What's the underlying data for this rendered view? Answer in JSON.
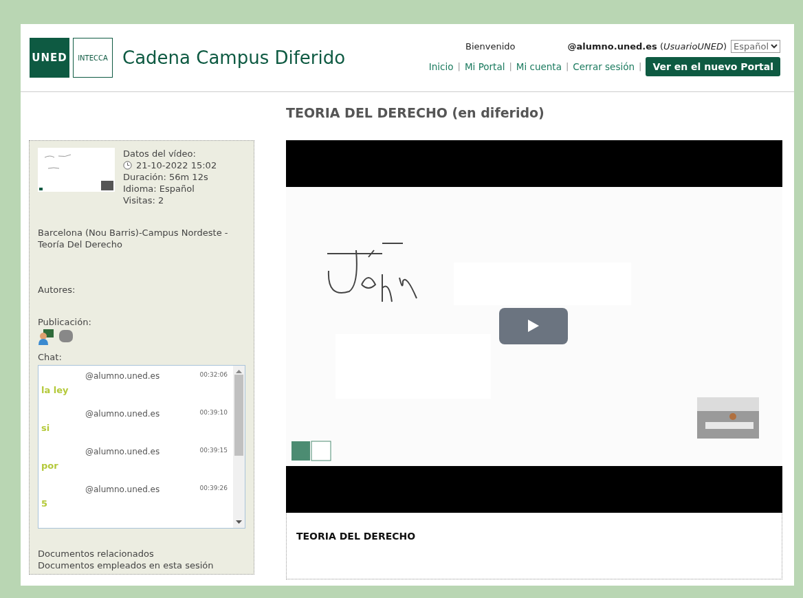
{
  "header": {
    "logo_primary": "UNED",
    "logo_secondary": "INTECCA",
    "site_title": "Cadena Campus Diferido",
    "welcome": "Bienvenido",
    "user_email": "@alumno.uned.es",
    "user_name": "(*UsuarioUNED*)",
    "language": "Español",
    "nav": [
      {
        "label": "Inicio",
        "separator": "|"
      },
      {
        "label": "Mi Portal",
        "separator": "|"
      },
      {
        "label": "Mi cuenta",
        "separator": "|"
      },
      {
        "label": "Cerrar sesión",
        "separator": "|"
      }
    ],
    "portal_button": "Ver en el nuevo Portal"
  },
  "page_title": "TEORIA DEL DERECHO (en diferido)",
  "sidebar": {
    "details_heading": "Datos del vídeo:",
    "date": "21-10-2022 15:02",
    "duration": "Duración: 56m 12s",
    "language": "Idioma: Español",
    "visits": "Visitas: 2",
    "description": "Barcelona (Nou Barris)-Campus Nordeste - Teoría Del Derecho",
    "authors_label": "Autores:",
    "publication_label": "Publicación:",
    "chat_label": "Chat:",
    "chat": [
      {
        "user": "@alumno.uned.es",
        "time": "00:32:06",
        "message": "la ley"
      },
      {
        "user": "@alumno.uned.es",
        "time": "00:39:10",
        "message": "si"
      },
      {
        "user": "@alumno.uned.es",
        "time": "00:39:15",
        "message": "por"
      },
      {
        "user": "@alumno.uned.es",
        "time": "00:39:26",
        "message": "5"
      }
    ],
    "links": [
      "Documentos relacionados",
      "Documentos empleados en esta sesión"
    ]
  },
  "player": {
    "caption": "TEORIA DEL DERECHO"
  }
}
